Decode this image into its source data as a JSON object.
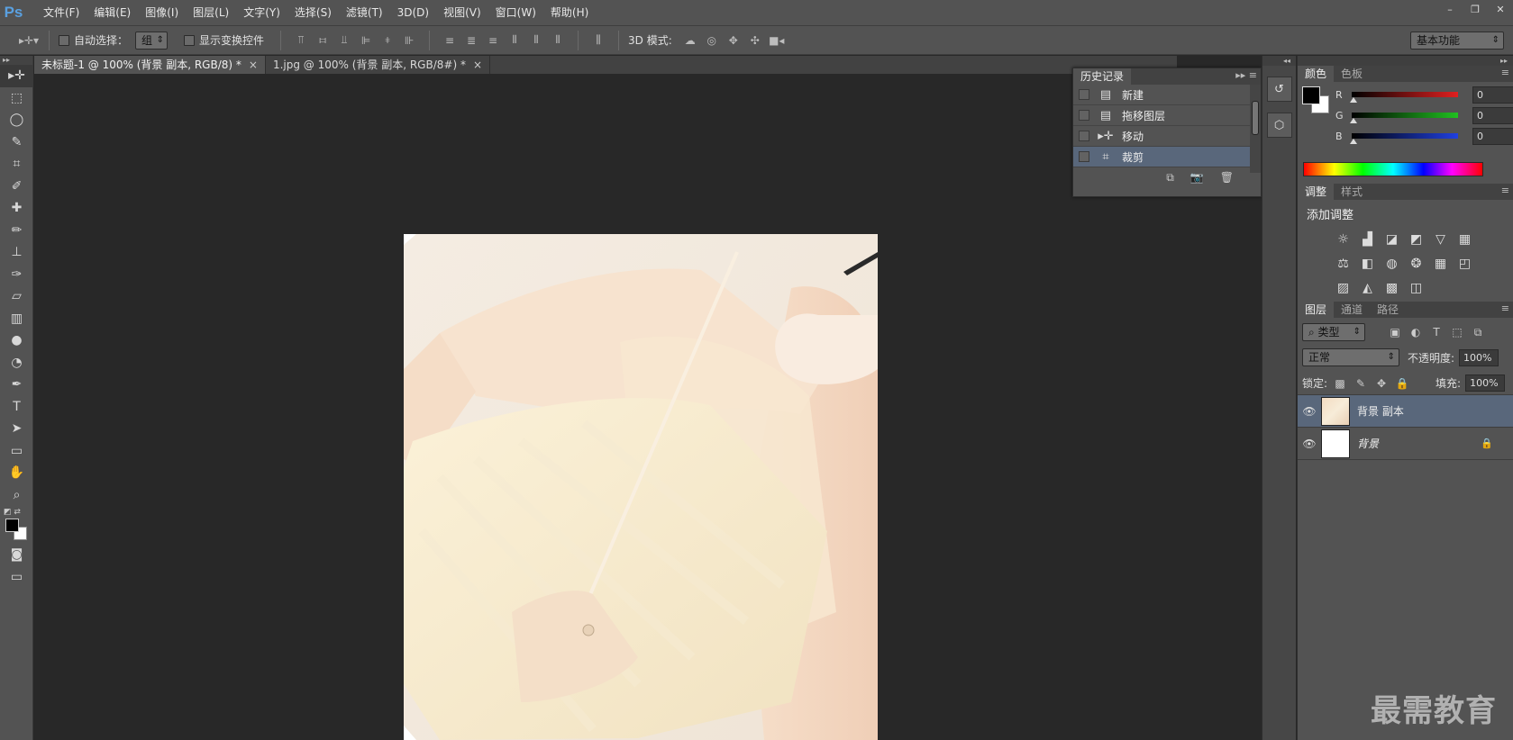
{
  "app": {
    "logo": "Ps",
    "accent": "#5aa0e0"
  },
  "menu": [
    "文件(F)",
    "编辑(E)",
    "图像(I)",
    "图层(L)",
    "文字(Y)",
    "选择(S)",
    "滤镜(T)",
    "3D(D)",
    "视图(V)",
    "窗口(W)",
    "帮助(H)"
  ],
  "window_controls": {
    "minimize": "–",
    "restore": "❐",
    "close": "✕"
  },
  "options": {
    "auto_select_label": "自动选择：",
    "auto_select_value": "组",
    "transform_label": "显示变换控件",
    "mode3d_label": "3D 模式:",
    "workspace": "基本功能"
  },
  "tabs": [
    {
      "label": "未标题-1 @ 100% (背景 副本, RGB/8) *",
      "close": "×"
    },
    {
      "label": "1.jpg @ 100% (背景 副本, RGB/8#) *",
      "close": "×"
    }
  ],
  "tools": [
    "move-tool",
    "marquee-tool",
    "lasso-tool",
    "quick-select-tool",
    "crop-tool",
    "eyedropper-tool",
    "healing-brush-tool",
    "brush-tool",
    "clone-stamp-tool",
    "history-brush-tool",
    "eraser-tool",
    "gradient-tool",
    "blur-tool",
    "dodge-tool",
    "pen-tool",
    "type-tool",
    "path-select-tool",
    "rectangle-tool",
    "hand-tool",
    "zoom-tool"
  ],
  "history": {
    "tab": "历史记录",
    "items": [
      {
        "label": "新建",
        "icon": "document-icon"
      },
      {
        "label": "拖移图层",
        "icon": "document-icon"
      },
      {
        "label": "移动",
        "icon": "move-icon"
      },
      {
        "label": "裁剪",
        "icon": "crop-icon"
      }
    ],
    "selected_index": 3
  },
  "color_panel": {
    "tabs": [
      "颜色",
      "色板"
    ],
    "channels": [
      {
        "label": "R",
        "value": "0",
        "color": "#e02020"
      },
      {
        "label": "G",
        "value": "0",
        "color": "#20c020"
      },
      {
        "label": "B",
        "value": "0",
        "color": "#2040e0"
      }
    ],
    "foreground": "#000000",
    "background": "#ffffff"
  },
  "adjust_panel": {
    "tabs": [
      "调整",
      "样式"
    ],
    "title": "添加调整"
  },
  "layers_panel": {
    "tabs": [
      "图层",
      "通道",
      "路径"
    ],
    "filter": "类型",
    "blend_mode": "正常",
    "opacity_label": "不透明度:",
    "opacity": "100%",
    "lock_label": "锁定:",
    "fill_label": "填充:",
    "fill": "100%",
    "layers": [
      {
        "name": "背景 副本",
        "selected": true
      },
      {
        "name": "背景",
        "selected": false,
        "locked": true
      }
    ]
  },
  "watermark": "最需教育"
}
